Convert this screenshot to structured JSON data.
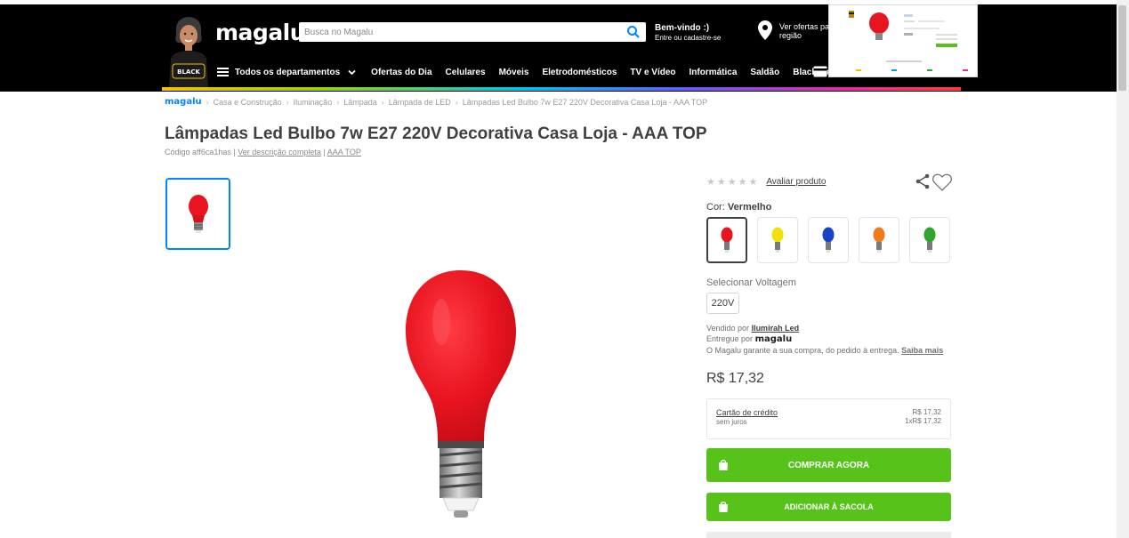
{
  "header": {
    "logo": "magalu",
    "search_placeholder": "Busca no Magalu",
    "welcome_line1": "Bem-vindo :)",
    "welcome_line2": "Entre ou cadastre-se",
    "offers_region_line1": "Ver ofertas para",
    "offers_region_line2": "região",
    "mascot_badge": "BLACK",
    "nav": {
      "departments": "Todos os departamentos",
      "items": [
        "Ofertas do Dia",
        "Celulares",
        "Móveis",
        "Eletrodomésticos",
        "TV e Vídeo",
        "Informática",
        "Saldão",
        "Black das Blacks"
      ]
    }
  },
  "breadcrumb": {
    "logo": "magalu",
    "items": [
      "Casa e Construção",
      "Iluminação",
      "Lâmpada",
      "Lâmpada de LED",
      "Lâmpadas Led Bulbo 7w E27 220V Decorativa Casa Loja - AAA TOP"
    ]
  },
  "product": {
    "title": "Lâmpadas Led Bulbo 7w E27 220V Decorativa Casa Loja - AAA TOP",
    "code": "Código aff6ca1has",
    "sep": "|",
    "desc_link": "Ver descrição completa",
    "brand_link": "AAA TOP",
    "rating_link": "Avaliar produto",
    "stars": "★★★★★",
    "color_label": "Cor:",
    "color_value": "Vermelho",
    "colors": [
      "#e8141f",
      "#f3e00f",
      "#1842c8",
      "#f07b1e",
      "#2fa52e"
    ],
    "voltage_label": "Selecionar Voltagem",
    "voltage_value": "220V",
    "sold_by_label": "Vendido por",
    "sold_by": "Ilumirah Led",
    "delivered_by_label": "Entregue por",
    "delivered_by": "magalu",
    "guarantee": "O Magalu garante a sua compra, do pedido à entrega.",
    "guarantee_link": "Saiba mais",
    "price": "R$ 17,32",
    "card_title": "Cartão de crédito",
    "card_sub": "sem juros",
    "card_price": "R$ 17,32",
    "card_installment": "1xR$ 17,32",
    "buy_button": "COMPRAR AGORA",
    "bag_button": "ADICIONAR À SACOLA"
  },
  "colors": {
    "header_bg": "#000000",
    "brand_blue": "#0086ff",
    "buy_green": "#57c21a",
    "bulb_red": "#e8141f"
  }
}
